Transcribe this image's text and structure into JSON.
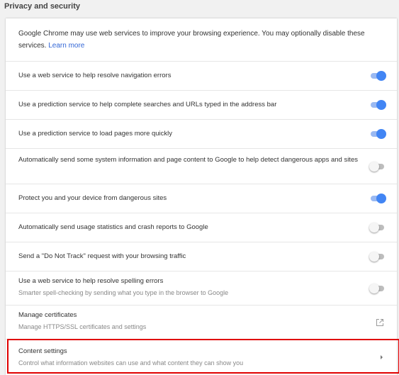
{
  "section": {
    "title": "Privacy and security"
  },
  "intro": {
    "text": "Google Chrome may use web services to improve your browsing experience. You may optionally disable these services.",
    "link": "Learn more"
  },
  "settings": [
    {
      "label": "Use a web service to help resolve navigation errors",
      "enabled": true
    },
    {
      "label": "Use a prediction service to help complete searches and URLs typed in the address bar",
      "enabled": true
    },
    {
      "label": "Use a prediction service to load pages more quickly",
      "enabled": true
    },
    {
      "label": "Automatically send some system information and page content to Google to help detect dangerous apps and sites",
      "enabled": false
    },
    {
      "label": "Protect you and your device from dangerous sites",
      "enabled": true
    },
    {
      "label": "Automatically send usage statistics and crash reports to Google",
      "enabled": false
    },
    {
      "label": "Send a \"Do Not Track\" request with your browsing traffic",
      "enabled": false
    },
    {
      "label": "Use a web service to help resolve spelling errors",
      "sub": "Smarter spell-checking by sending what you type in the browser to Google",
      "enabled": false
    }
  ],
  "manage_certificates": {
    "label": "Manage certificates",
    "sub": "Manage HTTPS/SSL certificates and settings",
    "icon": "external-link-icon"
  },
  "content_settings": {
    "label": "Content settings",
    "sub": "Control what information websites can use and what content they can show you",
    "icon": "chevron-right-icon"
  },
  "colors": {
    "accent": "#4285f4",
    "highlight": "#e00000"
  }
}
